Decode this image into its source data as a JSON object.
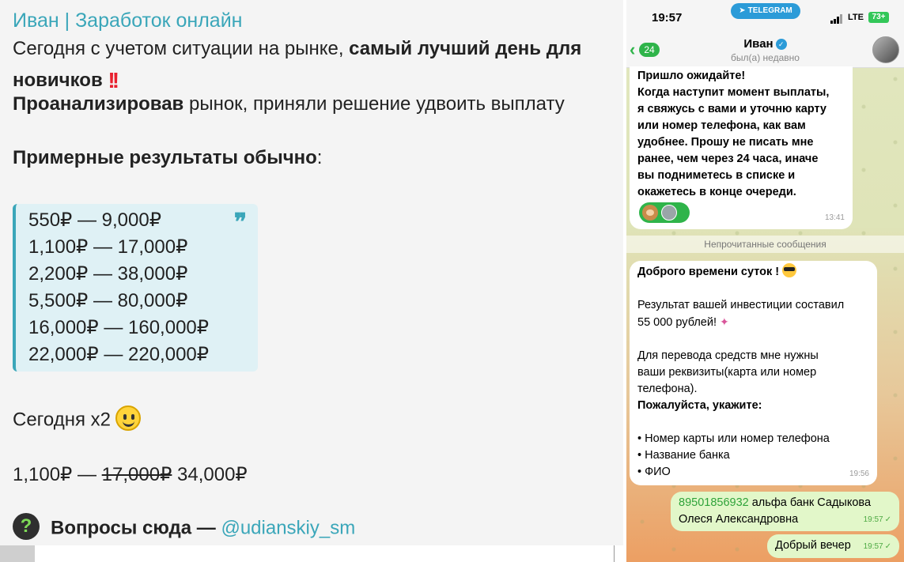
{
  "post": {
    "sender": "Иван | Заработок онлайн",
    "line1_normal": "Сегодня с учетом ситуации на рынке, ",
    "line1_bold": "самый лучший день для",
    "line2_bold": "новичков",
    "line3_bold": "Проанализировав",
    "line3_normal": " рынок, приняли решение удвоить выплату",
    "results_heading": "Примерные результаты обычно",
    "results_colon": ":",
    "tiers": [
      "550₽ — 9,000₽",
      "1,100₽ — 17,000₽",
      "2,200₽ — 38,000₽",
      "5,500₽ — 80,000₽",
      "16,000₽ — 160,000₽",
      "22,000₽ — 220,000₽"
    ],
    "today_label": "Сегодня x2",
    "today_deal_start": "1,100₽ — ",
    "today_deal_old": "17,000₽",
    "today_deal_new": " 34,000₽",
    "questions_label": "Вопросы сюда — ",
    "questions_handle": "@udianskiy_sm"
  },
  "phone": {
    "status": {
      "time": "19:57",
      "app_pill": "TELEGRAM",
      "network": "LTE",
      "battery": "73+"
    },
    "header": {
      "back_count": "24",
      "contact_name": "Иван",
      "contact_status": "был(а) недавно"
    },
    "messages": {
      "first": {
        "lines": [
          "Пришло ожидайте!",
          "Когда наступит момент выплаты,",
          "я свяжусь с вами и уточню карту",
          "или номер телефона, как вам",
          "удобнее. Прошу не писать мне",
          "ранее, чем через 24 часа, иначе",
          "вы подниметесь в списке и",
          "окажетесь в конце очереди."
        ],
        "time": "13:41"
      },
      "unread_label": "Непрочитанные сообщения",
      "second": {
        "greeting": "Доброго времени суток !",
        "result_line1": "Результат вашей инвестиции составил",
        "result_line2": "55 000 рублей!",
        "transfer_lines": [
          "Для перевода средств мне нужны",
          "ваши реквизиты(карта или номер",
          "телефона)."
        ],
        "please": "Пожалуйста, укажите:",
        "bullets": [
          "• Номер карты или номер телефона",
          "• Название банка",
          "• ФИО"
        ],
        "time": "19:56"
      },
      "reply1": {
        "phone_number": "89501856932",
        "rest_line1": " альфа банк Садыкова",
        "line2": "Олеся Александровна",
        "time": "19:57"
      },
      "reply2": {
        "text": "Добрый вечер",
        "time": "19:57"
      }
    }
  }
}
